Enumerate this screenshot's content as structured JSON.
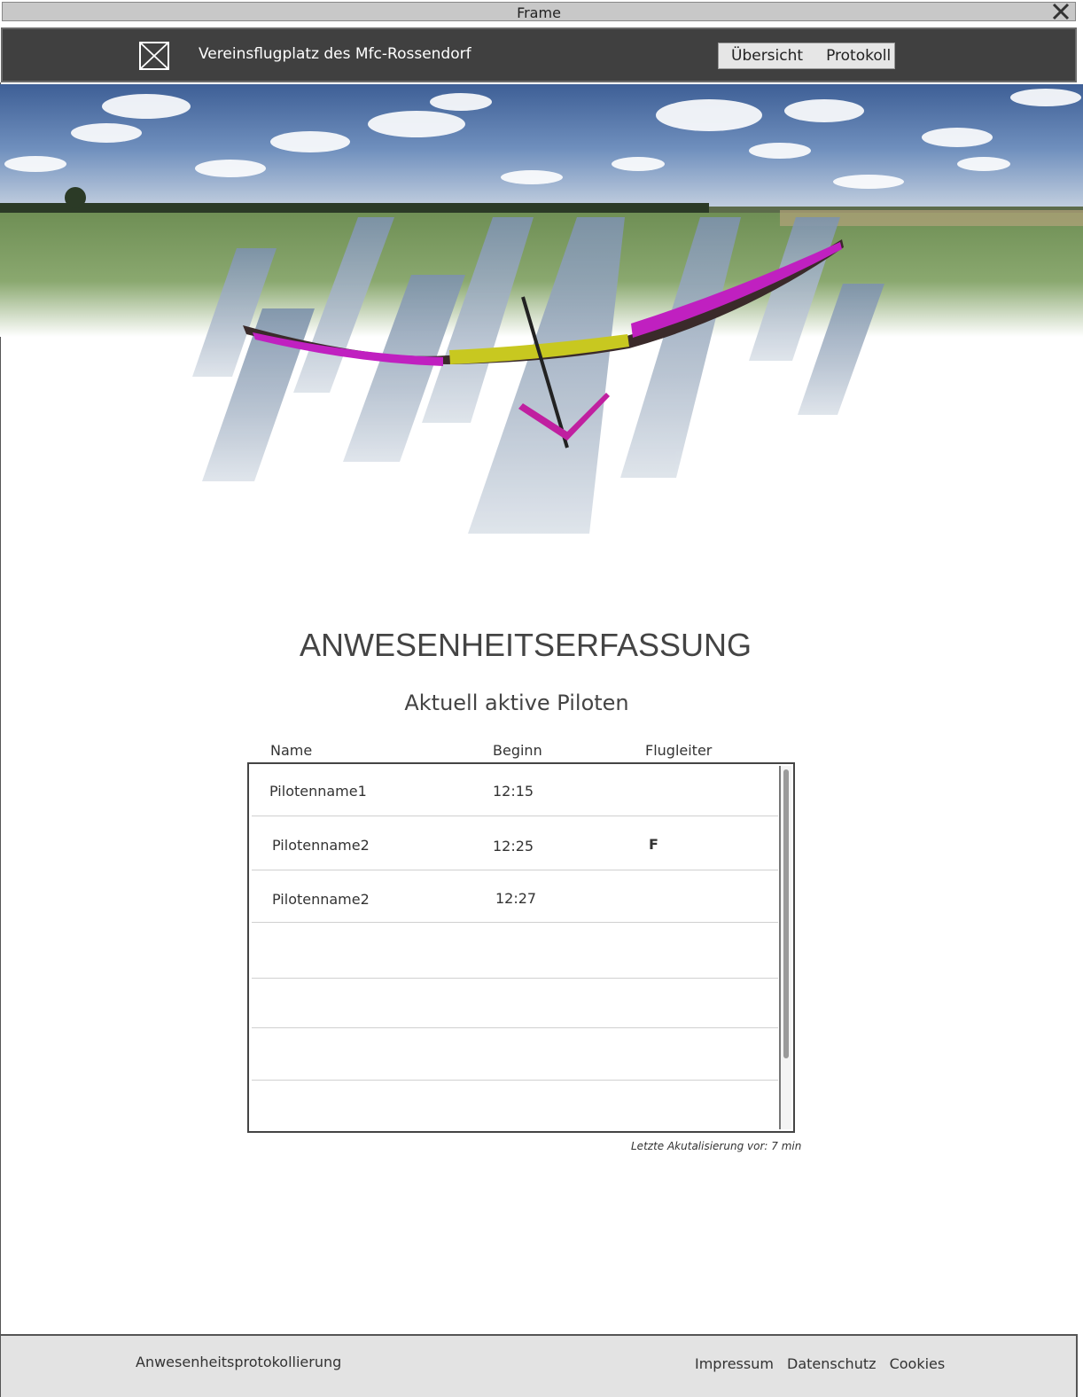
{
  "window": {
    "title": "Frame"
  },
  "header": {
    "site_title": "Vereinsflugplatz des Mfc-Rossendorf",
    "nav": [
      "Übersicht",
      "Protokoll"
    ]
  },
  "main": {
    "heading": "ANWESENHEITSERFASSUNG",
    "subheading": "Aktuell aktive Piloten",
    "columns": [
      "Name",
      "Beginn",
      "Flugleiter"
    ],
    "rows": [
      {
        "name": "Pilotenname1",
        "start": "12:15",
        "flight_director": ""
      },
      {
        "name": "Pilotenname2",
        "start": "12:25",
        "flight_director": "F"
      },
      {
        "name": "Pilotenname2",
        "start": "12:27",
        "flight_director": ""
      }
    ],
    "update_note": "Letzte Akutalisierung vor: 7 min"
  },
  "footer": {
    "brand": "Anwesenheitsprotokollierung",
    "links": [
      "Impressum",
      "Datenschutz",
      "Cookies"
    ]
  }
}
